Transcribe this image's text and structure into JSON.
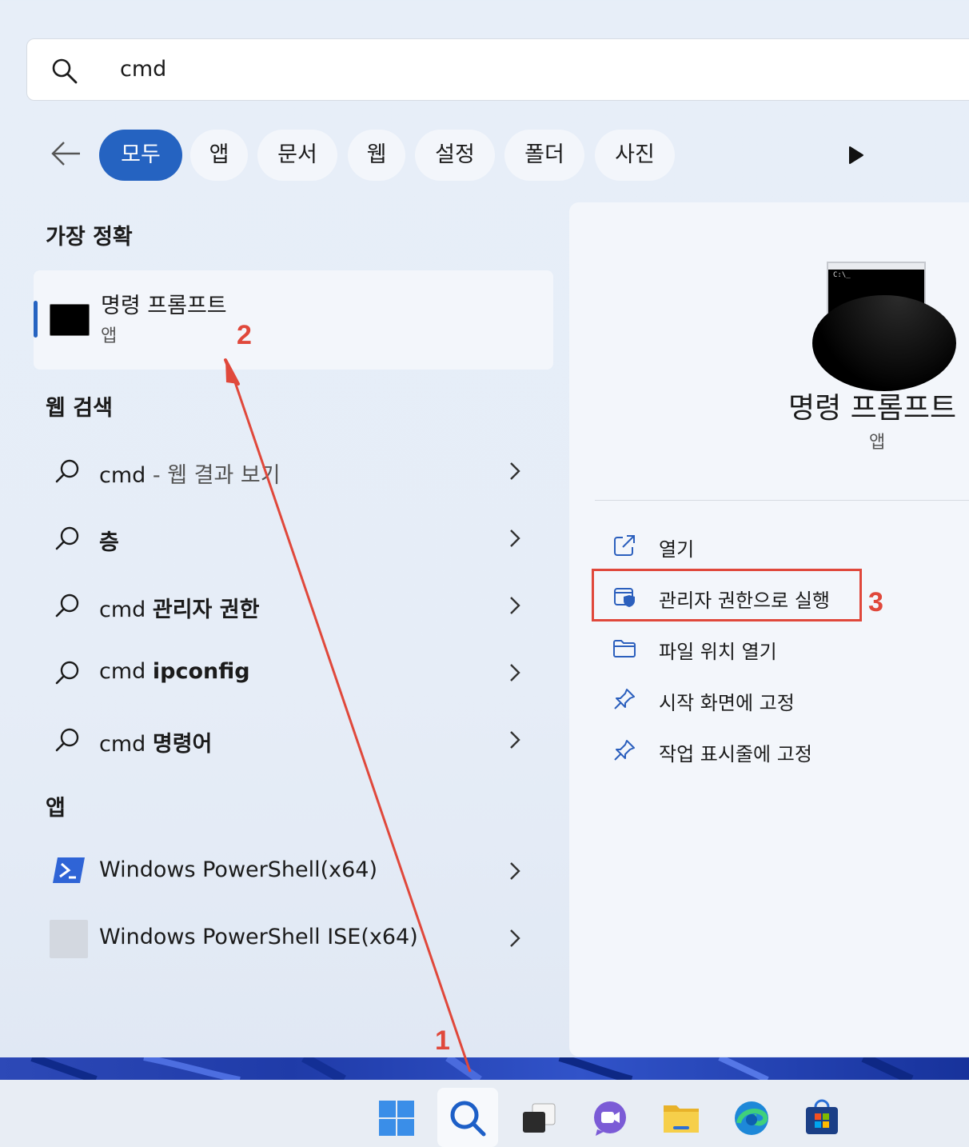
{
  "search": {
    "query": "cmd"
  },
  "filters": [
    "모두",
    "앱",
    "문서",
    "웹",
    "설정",
    "폴더",
    "사진"
  ],
  "sections": {
    "best_match": "가장 정확",
    "web_search": "웹 검색",
    "apps": "앱"
  },
  "best_match": {
    "name": "명령 프롬프트",
    "type": "앱"
  },
  "web_results": [
    {
      "prefix": "cmd",
      "bold": "",
      "suffix": " - 웹 결과 보기"
    },
    {
      "prefix": "",
      "bold": "층",
      "suffix": ""
    },
    {
      "prefix": "cmd ",
      "bold": "관리자 권한",
      "suffix": ""
    },
    {
      "prefix": "cmd ",
      "bold": "ipconfig",
      "suffix": ""
    },
    {
      "prefix": "cmd ",
      "bold": "명령어",
      "suffix": ""
    }
  ],
  "apps": [
    {
      "name": "Windows PowerShell(x64)",
      "icon": "powershell-icon"
    },
    {
      "name": "Windows PowerShell ISE(x64)",
      "icon": "powershell-ise-icon"
    }
  ],
  "detail": {
    "title": "명령 프롬프트",
    "type": "앱",
    "icon_prompt": "C:\\_",
    "actions": [
      "열기",
      "관리자 권한으로 실행",
      "파일 위치 열기",
      "시작 화면에 고정",
      "작업 표시줄에 고정"
    ]
  },
  "annotations": {
    "step1": "1",
    "step2": "2",
    "step3": "3"
  },
  "colors": {
    "accent": "#2563c1",
    "annotation": "#e0483b"
  },
  "taskbar": [
    "windows-start-icon",
    "search-icon",
    "task-view-icon",
    "teams-chat-icon",
    "file-explorer-icon",
    "edge-icon",
    "store-icon"
  ]
}
